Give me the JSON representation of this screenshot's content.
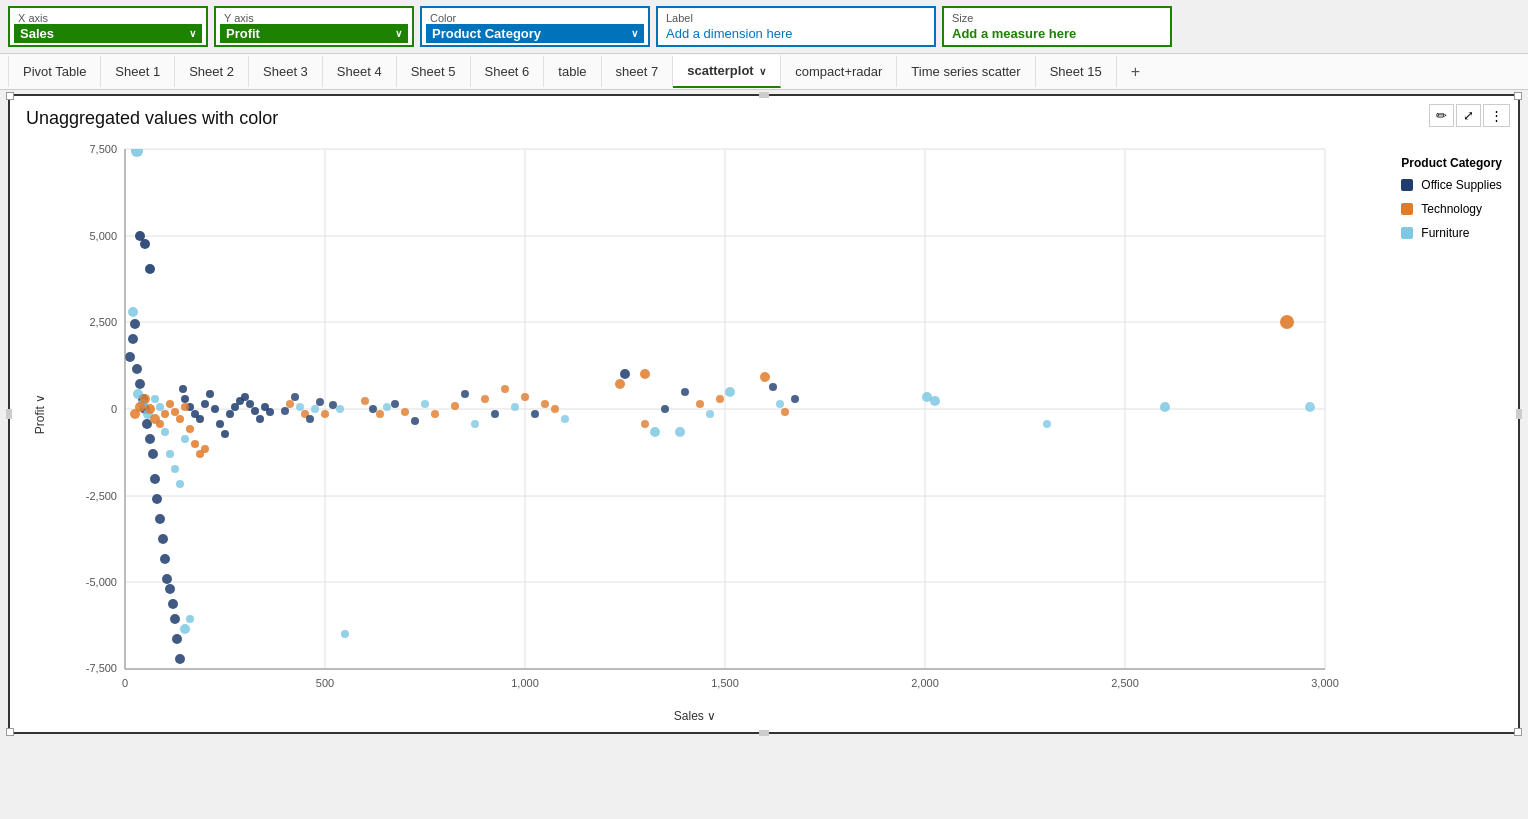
{
  "topbar": {
    "xaxis": {
      "label": "X axis",
      "value": "Sales",
      "style": "green-filled"
    },
    "yaxis": {
      "label": "Y axis",
      "value": "Profit",
      "style": "green-filled"
    },
    "color": {
      "label": "Color",
      "value": "Product Category",
      "style": "blue-filled"
    },
    "label": {
      "label": "Label",
      "value": "Add a dimension here",
      "style": "blue-outline"
    },
    "size": {
      "label": "Size",
      "value": "Add a measure here",
      "style": "green-outline"
    }
  },
  "tabs": {
    "items": [
      {
        "label": "Pivot Table",
        "active": false
      },
      {
        "label": "Sheet 1",
        "active": false
      },
      {
        "label": "Sheet 2",
        "active": false
      },
      {
        "label": "Sheet 3",
        "active": false
      },
      {
        "label": "Sheet 4",
        "active": false
      },
      {
        "label": "Sheet 5",
        "active": false
      },
      {
        "label": "Sheet 6",
        "active": false
      },
      {
        "label": "table",
        "active": false
      },
      {
        "label": "sheet 7",
        "active": false
      },
      {
        "label": "scatterplot",
        "active": true
      },
      {
        "label": "compact+radar",
        "active": false
      },
      {
        "label": "Time series scatter",
        "active": false
      },
      {
        "label": "Sheet 15",
        "active": false
      }
    ],
    "add_label": "+"
  },
  "chart": {
    "title": "Unaggregated values with color",
    "x_axis_label": "Sales ∨",
    "y_axis_label": "Profit ∨",
    "legend": {
      "title": "Product Category",
      "items": [
        {
          "label": "Office Supplies",
          "color": "#1f3d6e"
        },
        {
          "label": "Technology",
          "color": "#e07b2a"
        },
        {
          "label": "Furniture",
          "color": "#7ec8e3"
        }
      ]
    },
    "toolbar": {
      "edit": "✏",
      "expand": "⤢",
      "more": "⋮"
    }
  }
}
